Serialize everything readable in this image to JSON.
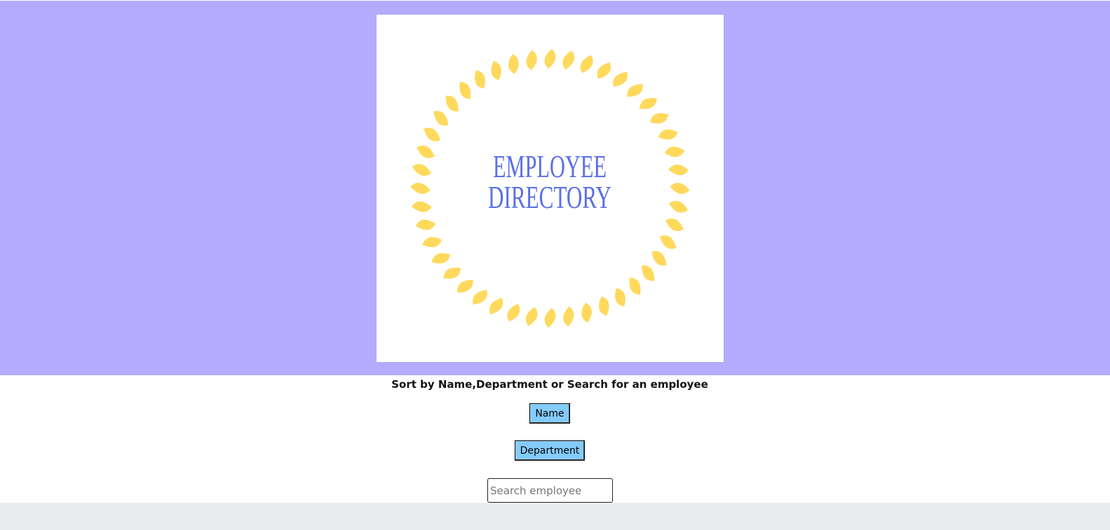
{
  "colors": {
    "hero_background": "#b4abff",
    "logo_card_background": "#ffffff",
    "rope_ring": "#ffd95c",
    "logo_text": "#5b6fe6",
    "button_background": "#83cbfb",
    "footer_background": "#e9edf0"
  },
  "logo": {
    "line1": "EMPLOYEE",
    "line2": "DIRECTORY"
  },
  "controls": {
    "heading": "Sort by Name,Department or Search for an employee",
    "name_button": "Name",
    "department_button": "Department",
    "search_placeholder": "Search employee",
    "search_value": ""
  }
}
